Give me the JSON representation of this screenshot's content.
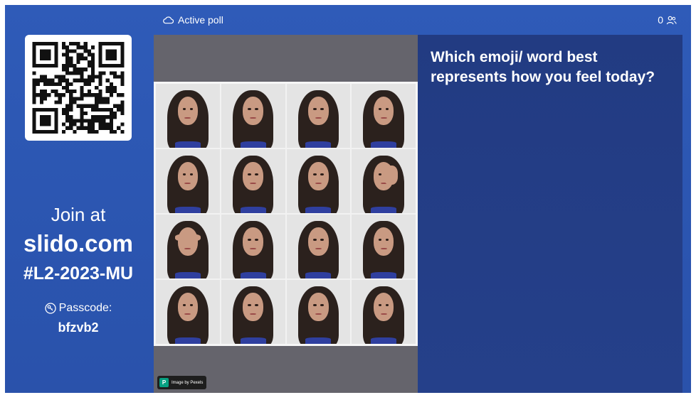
{
  "header": {
    "active_poll_label": "Active poll",
    "participant_count": "0"
  },
  "join": {
    "join_at_label": "Join at",
    "url": "slido.com",
    "event_code": "#L2-2023-MU",
    "passcode_label": "Passcode:",
    "passcode": "bfzvb2"
  },
  "image": {
    "credit_logo_letter": "P",
    "credit_text": "Image by Pexels",
    "grid_rows": 4,
    "grid_cols": 4
  },
  "poll": {
    "question": "Which emoji/ word best represents how you feel today?"
  },
  "colors": {
    "background": "#2f5bb8",
    "question_panel": "#223b82",
    "image_panel": "#65646c",
    "pexels_brand": "#06a081"
  },
  "icons": [
    "cloud-icon",
    "participants-icon",
    "key-icon",
    "qr-code",
    "pexels-logo-icon"
  ]
}
